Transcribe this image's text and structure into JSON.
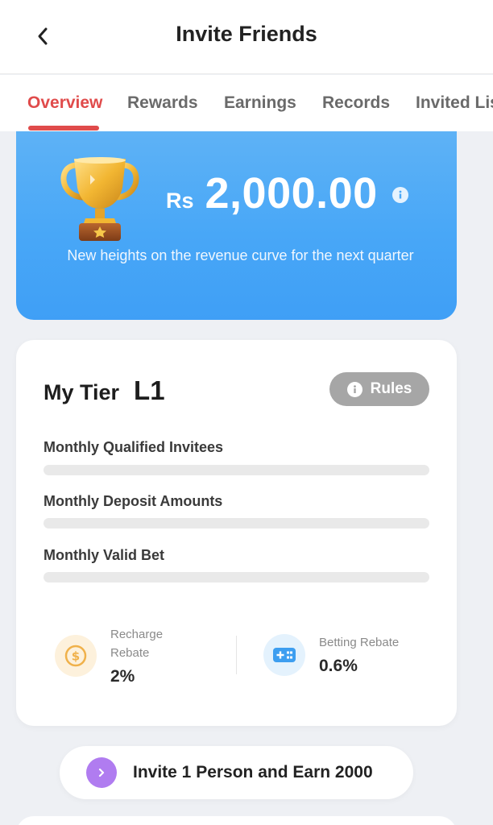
{
  "header": {
    "title": "Invite Friends",
    "back_icon": "chevron-left-icon"
  },
  "tabs": [
    {
      "label": "Overview",
      "active": true
    },
    {
      "label": "Rewards",
      "active": false
    },
    {
      "label": "Earnings",
      "active": false
    },
    {
      "label": "Records",
      "active": false
    },
    {
      "label": "Invited Lis",
      "active": false
    }
  ],
  "banner": {
    "icon": "trophy-icon",
    "currency": "Rs",
    "amount": "2,000.00",
    "info_icon": "info-icon",
    "subtitle": "New heights on the revenue curve for the next quarter",
    "colors": {
      "gradient_top": "#5eb2f6",
      "gradient_bottom": "#3f9ff6"
    }
  },
  "tier": {
    "label": "My Tier",
    "value": "L1",
    "rules_label": "Rules",
    "metrics": [
      {
        "label": "Monthly Qualified Invitees",
        "progress": 0
      },
      {
        "label": "Monthly Deposit Amounts",
        "progress": 0
      },
      {
        "label": "Monthly Valid Bet",
        "progress": 0
      }
    ],
    "rebates": [
      {
        "label": "Recharge Rebate",
        "value": "2%",
        "icon": "coin-icon"
      },
      {
        "label": "Betting Rebate",
        "value": "0.6%",
        "icon": "gamepad-icon"
      }
    ]
  },
  "invite": {
    "label": "Invite 1 Person and Earn 2000",
    "icon": "chevron-right-icon"
  },
  "colors": {
    "accent": "#e04b4b",
    "background": "#eef0f4",
    "rules_button": "#a6a6a6",
    "invite_arrow": "#b07cf0"
  }
}
